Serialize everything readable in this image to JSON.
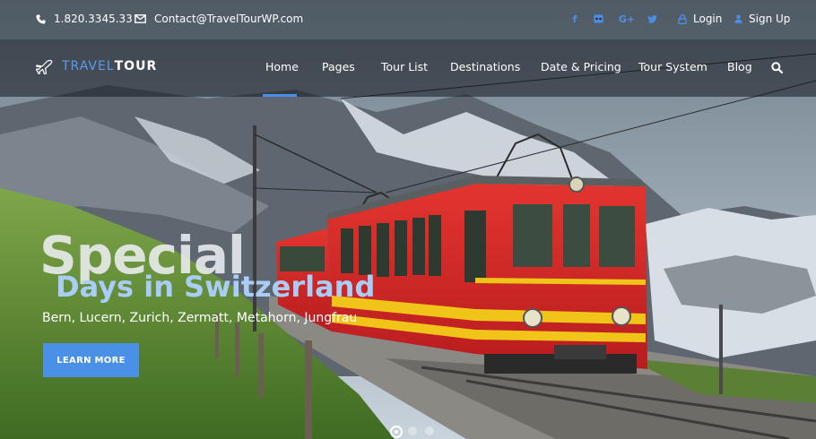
{
  "topbar": {
    "phone": "1.820.3345.33",
    "email": "Contact@TravelTourWP.com",
    "social": [
      "facebook-icon",
      "flickr-icon",
      "google-plus-icon",
      "twitter-icon"
    ],
    "login_label": "Login",
    "signup_label": "Sign Up"
  },
  "brand": {
    "part1": "TRAVEL",
    "part2": "TOUR"
  },
  "nav": {
    "items": [
      {
        "label": "Home",
        "active": true
      },
      {
        "label": "Pages"
      },
      {
        "label": "Tour List"
      },
      {
        "label": "Destinations"
      },
      {
        "label": "Date & Pricing"
      },
      {
        "label": "Tour System"
      },
      {
        "label": "Blog"
      }
    ]
  },
  "hero": {
    "headline": "Special",
    "subheadline": "Days in Switzerland",
    "places": "Bern, Lucern, Zurich, Zermatt, Metahorn, Jungfrau",
    "cta_label": "LEARN MORE"
  },
  "slider": {
    "count": 3,
    "active_index": 0
  },
  "colors": {
    "accent": "#4a90e6",
    "social": "#4d8fe6",
    "train": "#d9262a"
  }
}
